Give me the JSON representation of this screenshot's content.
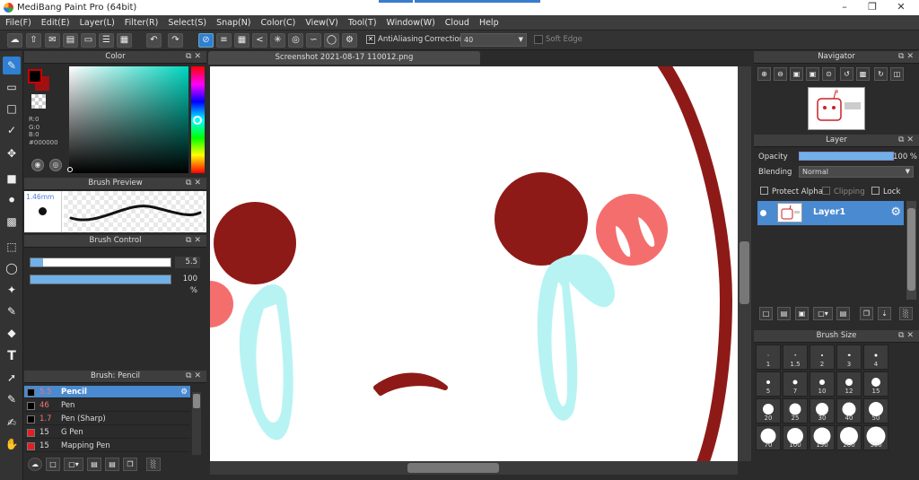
{
  "window": {
    "title": "MediBang Paint Pro (64bit)",
    "min_icon": "minimize-icon",
    "max_icon": "maximize-icon",
    "close_icon": "close-icon"
  },
  "menu": [
    "File(F)",
    "Edit(E)",
    "Layer(L)",
    "Filter(R)",
    "Select(S)",
    "Snap(N)",
    "Color(C)",
    "View(V)",
    "Tool(T)",
    "Window(W)",
    "Cloud",
    "Help"
  ],
  "toolbar": {
    "antialiasing_label": "AntiAliasing",
    "antialiasing_checked": true,
    "correction_label": "Correction",
    "correction_value": "40",
    "softedge_label": "Soft Edge",
    "softedge_checked": false
  },
  "color_panel": {
    "title": "Color",
    "r": "R:0",
    "g": "G:0",
    "b": "B:0",
    "hex": "#000000",
    "foreground": "#000000",
    "background": "#a01010"
  },
  "brush_preview": {
    "title": "Brush Preview",
    "size": "1.46mm"
  },
  "brush_control": {
    "title": "Brush Control",
    "size_value": "5.5",
    "size_fraction": 0.09,
    "opacity_value": "100 %",
    "opacity_fraction": 1.0
  },
  "brush_list": {
    "title": "Brush: Pencil",
    "items": [
      {
        "size": "5.5",
        "name": "Pencil",
        "color": "#000000",
        "selected": true
      },
      {
        "size": "46",
        "name": "Pen",
        "color": "#000000",
        "selected": false
      },
      {
        "size": "1.7",
        "name": "Pen (Sharp)",
        "color": "#000000",
        "selected": false
      },
      {
        "size": "15",
        "name": "G Pen",
        "color": "#e02020",
        "selected": false
      },
      {
        "size": "15",
        "name": "Mapping Pen",
        "color": "#e02020",
        "selected": false
      }
    ]
  },
  "document": {
    "tab": "Screenshot 2021-08-17 110012.png"
  },
  "navigator": {
    "title": "Navigator"
  },
  "layer_panel": {
    "title": "Layer",
    "opacity_label": "Opacity",
    "opacity_value": "100 %",
    "blending_label": "Blending",
    "blending_value": "Normal",
    "protect_alpha": "Protect Alpha",
    "clipping": "Clipping",
    "lock": "Lock",
    "layers": [
      {
        "name": "Layer1",
        "visible": true
      }
    ]
  },
  "brush_size": {
    "title": "Brush Size",
    "sizes": [
      "1",
      "1.5",
      "2",
      "3",
      "4",
      "5",
      "7",
      "10",
      "12",
      "15",
      "20",
      "25",
      "30",
      "40",
      "50",
      "70",
      "100",
      "150",
      "200",
      "300"
    ]
  },
  "colors": {
    "accent": "#2f7fd3",
    "selection": "#4a8ad0",
    "drawing_red": "#8e1a18",
    "drawing_pink": "#f56e6e",
    "drawing_cyan": "#b8f3f3"
  }
}
